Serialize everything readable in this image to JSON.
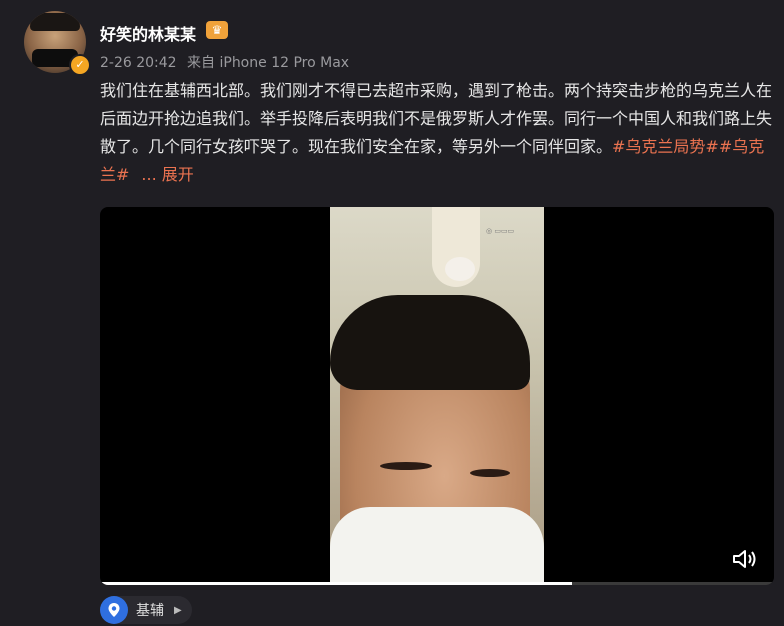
{
  "post": {
    "username": "好笑的林某某",
    "time": "2-26 20:42",
    "source": "来自 iPhone 12 Pro Max",
    "text": "我们住在基辅西北部。我们刚才不得已去超市采购，遇到了枪击。两个持突击步枪的乌克兰人在后面边开抢边追我们。举手投降后表明我们不是俄罗斯人才作罢。同行一个中国人和我们路上失散了。几个同行女孩吓哭了。现在我们安全在家，等另外一个同伴回家。",
    "hashtag_1": "#乌克兰局势#",
    "hashtag_2": "#乌克兰#",
    "ellipsis": "...",
    "expand_label": "展开"
  },
  "video": {
    "progress": 0.7
  },
  "location": {
    "label": "基辅"
  },
  "icons": {
    "verified": "verified-badge-icon",
    "crown": "crown-icon",
    "volume": "volume-icon",
    "location": "location-pin-icon",
    "arrow": "chevron-right-icon"
  },
  "colors": {
    "background": "#1f1e23",
    "link": "#eb7350",
    "verified": "#f5a623",
    "location_pin": "#2f6fe0"
  }
}
